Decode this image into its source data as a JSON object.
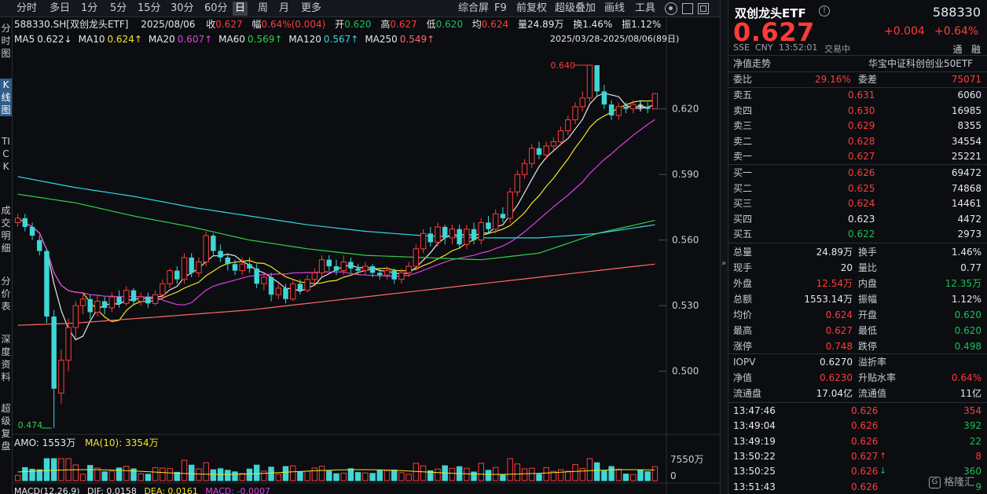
{
  "toolbar": {
    "periods": [
      "分时",
      "多日",
      "1分",
      "5分",
      "15分",
      "30分",
      "60分",
      "日",
      "周",
      "月",
      "更多"
    ],
    "active_period": "日",
    "right": [
      "综合屏",
      "F9",
      "前复权",
      "超级叠加",
      "画线",
      "工具"
    ]
  },
  "side_tabs": [
    "分时图",
    "K线图",
    "TICK",
    "成交明细",
    "分价表",
    "深度资料",
    "超级复盘"
  ],
  "chart_info": {
    "symbol": "588330.SH[双创龙头ETF]",
    "date": "2025/08/06",
    "close_label": "收",
    "close": "0.627",
    "amp_label": "幅",
    "amp": "0.64%(0.004)",
    "open_label": "开",
    "open": "0.620",
    "high_label": "高",
    "high": "0.627",
    "low_label": "低",
    "low": "0.620",
    "avg_label": "均",
    "avg": "0.624",
    "vol_label": "量",
    "vol": "24.89万",
    "turn_label": "换",
    "turn": "1.46%",
    "swing_label": "振",
    "swing": "1.12%",
    "range": "2025/03/28-2025/08/06(89日)"
  },
  "ma_legend": [
    {
      "label": "MA5",
      "value": "0.622↓",
      "color": "#e6e8eb"
    },
    {
      "label": "MA10",
      "value": "0.624↑",
      "color": "#f5e427"
    },
    {
      "label": "MA20",
      "value": "0.607↑",
      "color": "#e040e6"
    },
    {
      "label": "MA60",
      "value": "0.569↑",
      "color": "#2fd147"
    },
    {
      "label": "MA120",
      "value": "0.567↑",
      "color": "#33d6e6"
    },
    {
      "label": "MA250",
      "value": "0.549↑",
      "color": "#ff6a6a"
    }
  ],
  "amo_label": "AMO: 1553万",
  "amo_ma": "MA(10): 3354万",
  "vol_axis": [
    "7550万",
    "0"
  ],
  "macd_label": "MACD(12,26,9)",
  "macd_dif": "DIF: 0.0158",
  "macd_dea": "DEA: 0.0161",
  "macd_val": "MACD: -0.0007",
  "chart_data": {
    "type": "candlestick",
    "ylim": [
      0.474,
      0.64
    ],
    "yticks": [
      0.5,
      0.53,
      0.56,
      0.59,
      0.62
    ],
    "ytick_labels": [
      "0.500",
      "0.530",
      "0.560",
      "0.590",
      "0.620"
    ],
    "annotations": [
      {
        "label": "0.640",
        "value": 0.64
      },
      {
        "label": "0.474",
        "value": 0.474
      }
    ],
    "candles": [
      [
        0.568,
        0.57,
        0.572,
        0.566
      ],
      [
        0.57,
        0.566,
        0.572,
        0.564
      ],
      [
        0.566,
        0.562,
        0.568,
        0.56
      ],
      [
        0.56,
        0.555,
        0.562,
        0.553
      ],
      [
        0.555,
        0.525,
        0.556,
        0.522
      ],
      [
        0.525,
        0.492,
        0.528,
        0.474
      ],
      [
        0.49,
        0.505,
        0.51,
        0.485
      ],
      [
        0.505,
        0.52,
        0.524,
        0.5
      ],
      [
        0.52,
        0.53,
        0.532,
        0.515
      ],
      [
        0.53,
        0.533,
        0.535,
        0.526
      ],
      [
        0.533,
        0.527,
        0.535,
        0.524
      ],
      [
        0.527,
        0.532,
        0.535,
        0.525
      ],
      [
        0.532,
        0.529,
        0.534,
        0.526
      ],
      [
        0.529,
        0.534,
        0.536,
        0.527
      ],
      [
        0.534,
        0.531,
        0.537,
        0.529
      ],
      [
        0.531,
        0.537,
        0.539,
        0.53
      ],
      [
        0.537,
        0.532,
        0.538,
        0.53
      ],
      [
        0.532,
        0.534,
        0.536,
        0.53
      ],
      [
        0.534,
        0.531,
        0.536,
        0.529
      ],
      [
        0.531,
        0.535,
        0.537,
        0.53
      ],
      [
        0.535,
        0.54,
        0.542,
        0.533
      ],
      [
        0.54,
        0.546,
        0.547,
        0.538
      ],
      [
        0.546,
        0.542,
        0.548,
        0.54
      ],
      [
        0.542,
        0.552,
        0.554,
        0.54
      ],
      [
        0.552,
        0.545,
        0.554,
        0.543
      ],
      [
        0.545,
        0.55,
        0.552,
        0.543
      ],
      [
        0.55,
        0.562,
        0.564,
        0.548
      ],
      [
        0.562,
        0.555,
        0.563,
        0.553
      ],
      [
        0.555,
        0.552,
        0.558,
        0.55
      ],
      [
        0.552,
        0.549,
        0.554,
        0.546
      ],
      [
        0.549,
        0.546,
        0.551,
        0.544
      ],
      [
        0.546,
        0.549,
        0.552,
        0.544
      ],
      [
        0.549,
        0.547,
        0.552,
        0.545
      ],
      [
        0.547,
        0.54,
        0.549,
        0.538
      ],
      [
        0.54,
        0.543,
        0.545,
        0.537
      ],
      [
        0.543,
        0.535,
        0.545,
        0.532
      ],
      [
        0.535,
        0.538,
        0.54,
        0.533
      ],
      [
        0.538,
        0.533,
        0.54,
        0.531
      ],
      [
        0.533,
        0.54,
        0.542,
        0.532
      ],
      [
        0.54,
        0.537,
        0.542,
        0.535
      ],
      [
        0.537,
        0.542,
        0.544,
        0.536
      ],
      [
        0.542,
        0.545,
        0.547,
        0.54
      ],
      [
        0.545,
        0.551,
        0.553,
        0.543
      ],
      [
        0.551,
        0.548,
        0.553,
        0.546
      ],
      [
        0.548,
        0.546,
        0.551,
        0.544
      ],
      [
        0.546,
        0.55,
        0.553,
        0.544
      ],
      [
        0.55,
        0.547,
        0.552,
        0.545
      ],
      [
        0.547,
        0.546,
        0.549,
        0.544
      ],
      [
        0.546,
        0.548,
        0.55,
        0.544
      ],
      [
        0.548,
        0.545,
        0.549,
        0.543
      ],
      [
        0.545,
        0.544,
        0.547,
        0.542
      ],
      [
        0.544,
        0.546,
        0.548,
        0.542
      ],
      [
        0.546,
        0.542,
        0.547,
        0.54
      ],
      [
        0.542,
        0.545,
        0.547,
        0.54
      ],
      [
        0.545,
        0.548,
        0.55,
        0.543
      ],
      [
        0.548,
        0.556,
        0.558,
        0.546
      ],
      [
        0.556,
        0.563,
        0.565,
        0.554
      ],
      [
        0.563,
        0.559,
        0.566,
        0.557
      ],
      [
        0.559,
        0.566,
        0.568,
        0.557
      ],
      [
        0.566,
        0.561,
        0.567,
        0.558
      ],
      [
        0.561,
        0.565,
        0.567,
        0.558
      ],
      [
        0.565,
        0.558,
        0.567,
        0.556
      ],
      [
        0.558,
        0.565,
        0.567,
        0.556
      ],
      [
        0.565,
        0.56,
        0.568,
        0.558
      ],
      [
        0.56,
        0.568,
        0.57,
        0.558
      ],
      [
        0.568,
        0.565,
        0.571,
        0.563
      ],
      [
        0.565,
        0.572,
        0.574,
        0.563
      ],
      [
        0.572,
        0.57,
        0.575,
        0.568
      ],
      [
        0.57,
        0.582,
        0.584,
        0.568
      ],
      [
        0.582,
        0.59,
        0.592,
        0.58
      ],
      [
        0.59,
        0.595,
        0.597,
        0.588
      ],
      [
        0.595,
        0.602,
        0.604,
        0.593
      ],
      [
        0.602,
        0.599,
        0.605,
        0.597
      ],
      [
        0.599,
        0.603,
        0.605,
        0.597
      ],
      [
        0.603,
        0.605,
        0.607,
        0.601
      ],
      [
        0.605,
        0.61,
        0.612,
        0.603
      ],
      [
        0.61,
        0.615,
        0.617,
        0.608
      ],
      [
        0.615,
        0.621,
        0.623,
        0.613
      ],
      [
        0.621,
        0.625,
        0.628,
        0.619
      ],
      [
        0.625,
        0.64,
        0.64,
        0.623
      ],
      [
        0.64,
        0.628,
        0.64,
        0.626
      ],
      [
        0.628,
        0.622,
        0.631,
        0.62
      ],
      [
        0.622,
        0.617,
        0.624,
        0.615
      ],
      [
        0.617,
        0.621,
        0.623,
        0.615
      ],
      [
        0.621,
        0.62,
        0.623,
        0.618
      ],
      [
        0.62,
        0.622,
        0.624,
        0.618
      ],
      [
        0.622,
        0.621,
        0.624,
        0.619
      ],
      [
        0.621,
        0.62,
        0.623,
        0.618
      ],
      [
        0.62,
        0.627,
        0.627,
        0.62
      ]
    ]
  },
  "panel": {
    "name": "双创龙头ETF",
    "code": "588330",
    "price": "0.627",
    "change": "+0.004",
    "change_pct": "+0.64%",
    "exchange": "SSE",
    "currency": "CNY",
    "time": "13:52:01",
    "status": "交易中",
    "flags": [
      "通",
      "融"
    ],
    "nav_label": "净值走势",
    "index_label": "华宝中证科创创业50ETF",
    "weibi_label": "委比",
    "weibi": "29.16%",
    "weicha_label": "委差",
    "weicha": "75071",
    "asks": [
      {
        "label": "卖五",
        "price": "0.631",
        "vol": "6060"
      },
      {
        "label": "卖四",
        "price": "0.630",
        "vol": "16985"
      },
      {
        "label": "卖三",
        "price": "0.629",
        "vol": "8355"
      },
      {
        "label": "卖二",
        "price": "0.628",
        "vol": "34554"
      },
      {
        "label": "卖一",
        "price": "0.627",
        "vol": "25221"
      }
    ],
    "bids": [
      {
        "label": "买一",
        "price": "0.626",
        "vol": "69472"
      },
      {
        "label": "买二",
        "price": "0.625",
        "vol": "74868"
      },
      {
        "label": "买三",
        "price": "0.624",
        "vol": "14461"
      },
      {
        "label": "买四",
        "price": "0.623",
        "vol": "4472"
      },
      {
        "label": "买五",
        "price": "0.622",
        "vol": "2973"
      }
    ],
    "stats": [
      {
        "l1": "总量",
        "v1": "24.89万",
        "c1": "white",
        "l2": "换手",
        "v2": "1.46%",
        "c2": "white"
      },
      {
        "l1": "现手",
        "v1": "20",
        "c1": "white",
        "l2": "量比",
        "v2": "0.77",
        "c2": "white"
      },
      {
        "l1": "外盘",
        "v1": "12.54万",
        "c1": "red",
        "l2": "内盘",
        "v2": "12.35万",
        "c2": "green"
      },
      {
        "l1": "总额",
        "v1": "1553.14万",
        "c1": "white",
        "l2": "振幅",
        "v2": "1.12%",
        "c2": "white"
      },
      {
        "l1": "均价",
        "v1": "0.624",
        "c1": "red",
        "l2": "开盘",
        "v2": "0.620",
        "c2": "green"
      },
      {
        "l1": "最高",
        "v1": "0.627",
        "c1": "red",
        "l2": "最低",
        "v2": "0.620",
        "c2": "green"
      },
      {
        "l1": "涨停",
        "v1": "0.748",
        "c1": "red",
        "l2": "跌停",
        "v2": "0.498",
        "c2": "green"
      }
    ],
    "iopv_stats": [
      {
        "l1": "IOPV",
        "v1": "0.6270",
        "c1": "white",
        "l2": "溢折率",
        "v2": "",
        "c2": "white"
      },
      {
        "l1": "净值",
        "v1": "0.6230",
        "c1": "red",
        "l2": "升贴水率",
        "v2": "0.64%",
        "c2": "red"
      },
      {
        "l1": "流通盘",
        "v1": "17.04亿",
        "c1": "white",
        "l2": "流通值",
        "v2": "11亿",
        "c2": "white"
      }
    ],
    "trades": [
      {
        "time": "13:47:46",
        "price": "0.626",
        "vol": "354",
        "dir": "",
        "vc": "red"
      },
      {
        "time": "13:49:04",
        "price": "0.626",
        "vol": "392",
        "dir": "",
        "vc": "green"
      },
      {
        "time": "13:49:19",
        "price": "0.626",
        "vol": "22",
        "dir": "",
        "vc": "green"
      },
      {
        "time": "13:50:22",
        "price": "0.627",
        "vol": "8",
        "dir": "↑",
        "vc": "red"
      },
      {
        "time": "13:50:25",
        "price": "0.626",
        "vol": "360",
        "dir": "↓",
        "vc": "green"
      },
      {
        "time": "13:51:43",
        "price": "0.626",
        "vol": "9",
        "dir": "",
        "vc": "green"
      }
    ],
    "watermark": "格隆汇"
  },
  "colors": {
    "up": "#ff3b3b",
    "down": "#3fd6d6",
    "bg": "#0b0d10",
    "grid": "#1e232a"
  }
}
